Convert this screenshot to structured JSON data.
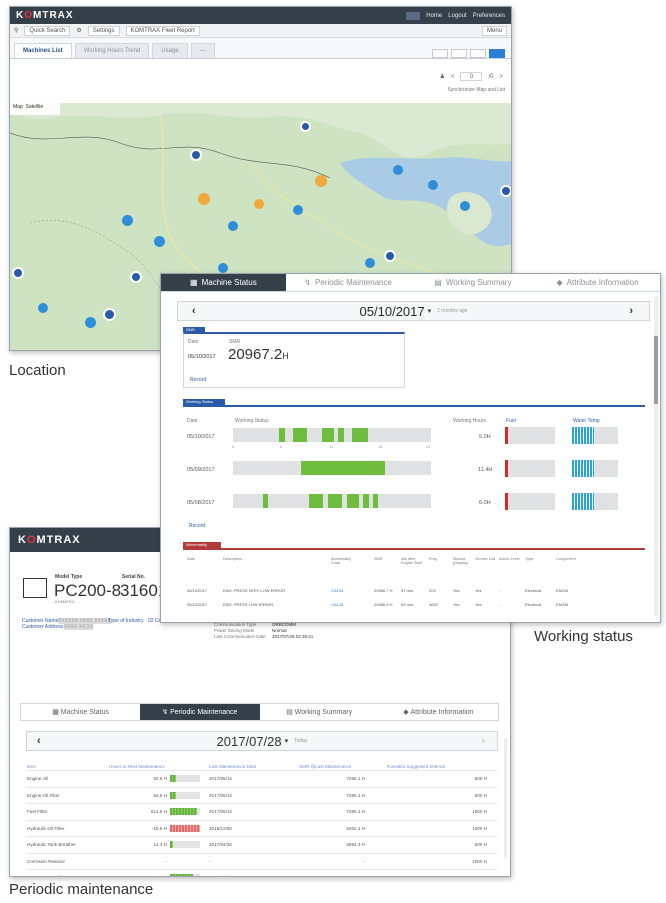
{
  "captions": {
    "location": "Location",
    "working_status": "Working status",
    "periodic_maintenance": "Periodic maintenance"
  },
  "brand": {
    "name_prefix": "K",
    "name_o": "O",
    "name_suffix": "MTRAX"
  },
  "location_window": {
    "topnav": [
      "Home",
      "Logout",
      "Preferences"
    ],
    "quick_search": "Quick Search",
    "settings": "Settings",
    "report": "KOMTRAX Fleet Report",
    "menu": "Menu",
    "tabs": [
      "Machines List",
      "Working Hours Trend",
      "Usage"
    ],
    "pager_value": "0",
    "pager_total": "/0",
    "sync_label": "Synchronize Map and List",
    "map_toggle": [
      "Map",
      "Satellite"
    ]
  },
  "working_status_window": {
    "tabs": [
      "Machine Status",
      "Periodic Maintenance",
      "Working Summary",
      "Attribute Information"
    ],
    "date": "05/10/2017",
    "date_sub": "2 months ago",
    "smr_section": "SMR",
    "smr_date_label": "Date",
    "smr_label": "SMR",
    "smr_date": "05/10/2017",
    "smr_value": "20967.2",
    "smr_unit": "H",
    "record_link": "Record",
    "working_section": "Working Status",
    "ws_headers": {
      "date": "Date",
      "status": "Working Status",
      "hours": "Working Hours",
      "fuel": "Fuel",
      "temp": "Water Temp"
    },
    "ws_rows": [
      {
        "date": "05/10/2017",
        "hours": "5.0H"
      },
      {
        "date": "05/09/2017",
        "hours": "11.4H"
      },
      {
        "date": "05/08/2017",
        "hours": "6.0H"
      }
    ],
    "ticks": [
      "0",
      "6",
      "12",
      "18",
      "24"
    ],
    "abnormality_section": "Abnormality",
    "ab_headers": [
      "Date",
      "Description",
      "Abnormality Code",
      "SMR",
      "Idle after Engine Start",
      "Freq",
      "Monitor (Display)",
      "Service Call",
      "Action Level",
      "Type",
      "Component"
    ],
    "ab_rows": [
      [
        "05/10/2017",
        "ENG. PRESS VERY LOW ERROR",
        "CA234",
        "20966.7 H",
        "97 min.",
        "203",
        "Yes",
        "Yes",
        "-",
        "Electrical",
        "ENGM"
      ],
      [
        "05/10/2017",
        "ENG. PRESS LOW ERROR",
        "CA135",
        "20966.3 H",
        "63 min.",
        "3620",
        "Yes",
        "Yes",
        "-",
        "Electrical",
        "ENGM"
      ]
    ]
  },
  "periodic_window": {
    "model_type_label": "Model Type",
    "serial_label": "Serial No.",
    "model": "PC200-8",
    "serial": "316011",
    "maker": "KOMATSU",
    "customer_name_label": "Customer Name",
    "customer_name": "XXXXXX XXXX XXXXX",
    "industry_label": "Type of Industry",
    "industry": "02 Construction",
    "customer_address_label": "Customer Address",
    "customer_address": "XXXX XX XX",
    "comm": [
      {
        "label": "Communication Setting",
        "value": "Completed"
      },
      {
        "label": "Communication Type",
        "value": "ORBCOMM"
      },
      {
        "label": "Power Saving Mode",
        "value": "Normal"
      },
      {
        "label": "Last Communication Date",
        "value": "2017/07/28 02:39:21"
      }
    ],
    "tabs": [
      "Machine Status",
      "Periodic Maintenance",
      "Working Summary",
      "Attribute Information"
    ],
    "date": "2017/07/28",
    "date_sub": "Today",
    "headers": {
      "item": "Item",
      "hours": "Hours to Next Maintenance",
      "last_date": "Last Maintenance Date",
      "smr": "SMR @Last Maintenance",
      "interval": "Komatsu Suggested Interval"
    },
    "rows": [
      {
        "item": "Engine Oil",
        "hours": "62.5 H",
        "fill": 0.2,
        "status": "ok",
        "last_date": "2017/06/12",
        "smr": "7286.1 H",
        "interval": "500 H"
      },
      {
        "item": "Engine Oil Filter",
        "hours": "62.5 H",
        "fill": 0.2,
        "status": "ok",
        "last_date": "2017/06/12",
        "smr": "7286.1 H",
        "interval": "500 H"
      },
      {
        "item": "Fuel Filter",
        "hours": "612.5 H",
        "fill": 0.9,
        "status": "ok",
        "last_date": "2017/06/12",
        "smr": "7286.1 H",
        "interval": "1000 H"
      },
      {
        "item": "Hydraulic Oil Filter",
        "hours": "-15.6 H",
        "fill": 1.0,
        "status": "overdue",
        "last_date": "2016/12/90",
        "smr": "6462.1 H",
        "interval": "1000 H"
      },
      {
        "item": "Hydraulic Tank Breather",
        "hours": "14.3 H",
        "fill": 0.1,
        "status": "ok",
        "last_date": "2017/04/25",
        "smr": "6694.3 H",
        "interval": "500 H"
      },
      {
        "item": "Corrosion Resistor",
        "hours": "-",
        "fill": 0,
        "status": "none",
        "last_date": "-",
        "smr": "-",
        "interval": "1000 H"
      },
      {
        "item": "Damper Case Oil",
        "hours": "701.6 H",
        "fill": 0.75,
        "status": "ok",
        "last_date": "2017/05/22",
        "smr": "7177.2 H",
        "interval": "1000 H"
      }
    ]
  }
}
